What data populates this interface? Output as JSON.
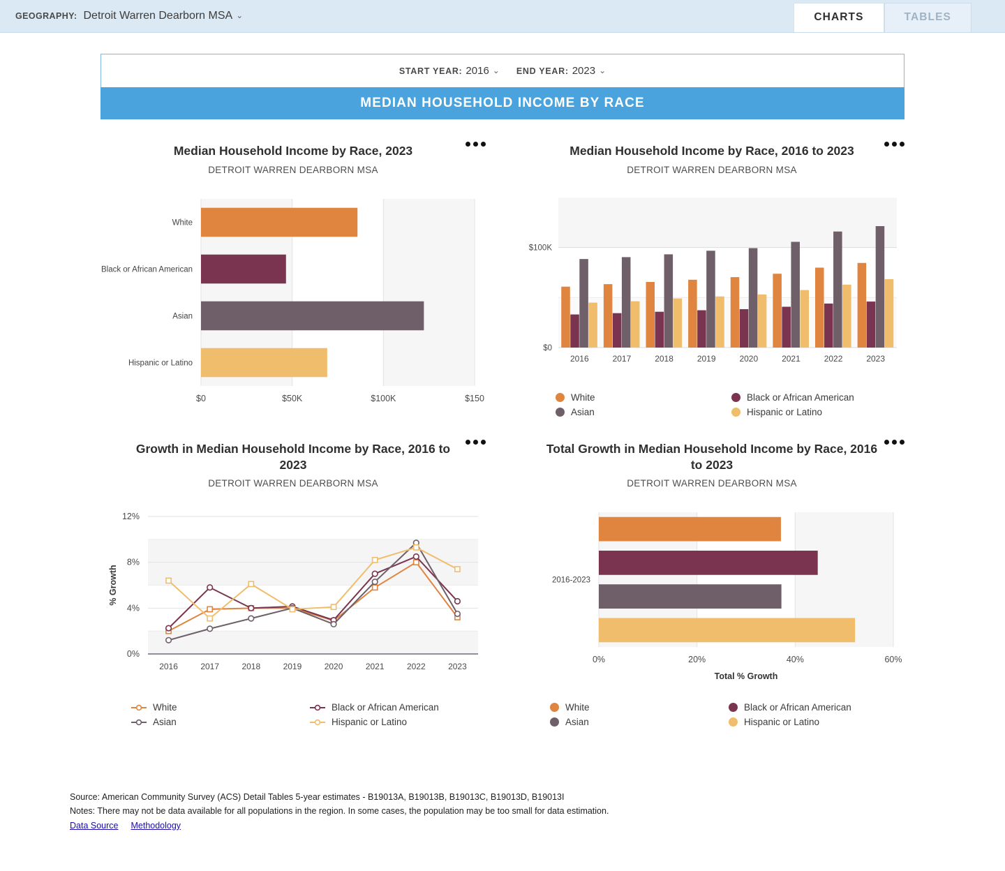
{
  "header": {
    "geography_label": "GEOGRAPHY:",
    "geography_value": "Detroit Warren Dearborn MSA",
    "tabs": [
      {
        "label": "CHARTS",
        "active": true
      },
      {
        "label": "TABLES",
        "active": false
      }
    ]
  },
  "controls": {
    "start_year_label": "START YEAR:",
    "start_year_value": "2016",
    "end_year_label": "END YEAR:",
    "end_year_value": "2023",
    "banner_title": "MEDIAN HOUSEHOLD INCOME BY RACE"
  },
  "colors": {
    "white": "#e08540",
    "black": "#7b3450",
    "asian": "#6f5f69",
    "hispanic": "#efbd6c",
    "accent": "#4aa3dd",
    "top_bar": "#dbe9f4",
    "band": "#f4f4f4"
  },
  "subtitle": "DETROIT WARREN DEARBORN MSA",
  "races": [
    "White",
    "Black or African American",
    "Asian",
    "Hispanic or Latino"
  ],
  "chart_data": [
    {
      "id": "income-2023",
      "type": "bar",
      "orientation": "horizontal",
      "title": "Median Household Income by Race, 2023",
      "subtitle": "DETROIT WARREN DEARBORN MSA",
      "categories": [
        "White",
        "Black or African American",
        "Asian",
        "Hispanic or Latino"
      ],
      "values": [
        85800,
        46600,
        122200,
        69200
      ],
      "colors": [
        "#e08540",
        "#7b3450",
        "#6f5f69",
        "#efbd6c"
      ],
      "xlabel": "",
      "ylabel": "",
      "xlim": [
        0,
        150000
      ],
      "xticks": [
        0,
        50000,
        100000,
        150000
      ],
      "xticklabels": [
        "$0",
        "$50K",
        "$100K",
        "$150"
      ],
      "grid": true,
      "legend": "none"
    },
    {
      "id": "income-series",
      "type": "bar",
      "orientation": "vertical",
      "grouped": true,
      "title": "Median Household Income by Race, 2016 to 2023",
      "subtitle": "DETROIT WARREN DEARBORN MSA",
      "categories": [
        "2016",
        "2017",
        "2018",
        "2019",
        "2020",
        "2021",
        "2022",
        "2023"
      ],
      "series": [
        {
          "name": "White",
          "color": "#e08540",
          "values": [
            60900,
            63400,
            65600,
            67800,
            70400,
            73800,
            79900,
            84600
          ]
        },
        {
          "name": "Black or African American",
          "color": "#7b3450",
          "values": [
            33100,
            34400,
            35800,
            37300,
            38400,
            40800,
            44000,
            46000
          ]
        },
        {
          "name": "Asian",
          "color": "#6f5f69",
          "values": [
            88500,
            90400,
            93200,
            96800,
            99400,
            105700,
            116000,
            121400
          ]
        },
        {
          "name": "Hispanic or Latino",
          "color": "#efbd6c",
          "values": [
            44900,
            46300,
            49100,
            51100,
            53100,
            57500,
            62900,
            68400
          ]
        }
      ],
      "ylim": [
        0,
        150000
      ],
      "yticks": [
        0,
        100000
      ],
      "yticklabels": [
        "$0",
        "$100K"
      ],
      "xlabel": "",
      "ylabel": "",
      "grid": true,
      "legend": "bottom",
      "legend_entries": [
        "White",
        "Black or African American",
        "Asian",
        "Hispanic or Latino"
      ]
    },
    {
      "id": "growth-lines",
      "type": "line",
      "title": "Growth in Median Household Income by Race, 2016 to 2023",
      "subtitle": "DETROIT WARREN DEARBORN MSA",
      "x": [
        "2016",
        "2017",
        "2018",
        "2019",
        "2020",
        "2021",
        "2022",
        "2023"
      ],
      "series": [
        {
          "name": "White",
          "color": "#e08540",
          "marker": "square",
          "values": [
            2.0,
            3.9,
            4.0,
            4.0,
            2.9,
            5.8,
            8.0,
            3.2
          ]
        },
        {
          "name": "Black or African American",
          "color": "#7b3450",
          "marker": "circle",
          "values": [
            2.25,
            5.8,
            4.0,
            4.15,
            2.95,
            7.0,
            8.5,
            4.6
          ]
        },
        {
          "name": "Asian",
          "color": "#6f5f69",
          "marker": "circle",
          "values": [
            1.2,
            2.2,
            3.1,
            4.0,
            2.6,
            6.3,
            9.7,
            3.5
          ]
        },
        {
          "name": "Hispanic or Latino",
          "color": "#efbd6c",
          "marker": "square",
          "values": [
            6.4,
            3.1,
            6.1,
            3.9,
            4.1,
            8.2,
            9.3,
            7.4
          ]
        }
      ],
      "ylim": [
        0,
        12
      ],
      "yticks": [
        0,
        4,
        8,
        12
      ],
      "yticklabels": [
        "0%",
        "4%",
        "8%",
        "12%"
      ],
      "ylabel": "% Growth",
      "xlabel": "",
      "grid": true,
      "legend": "bottom",
      "legend_entries": [
        "White",
        "Black or African American",
        "Asian",
        "Hispanic or Latino"
      ]
    },
    {
      "id": "total-growth",
      "type": "bar",
      "orientation": "horizontal",
      "title": "Total Growth in Median Household Income by Race, 2016 to 2023",
      "subtitle": "DETROIT WARREN DEARBORN MSA",
      "categories": [
        "White",
        "Black or African American",
        "Asian",
        "Hispanic or Latino"
      ],
      "group_label": "2016-2023",
      "values": [
        37.1,
        44.6,
        37.2,
        52.2
      ],
      "colors": [
        "#e08540",
        "#7b3450",
        "#6f5f69",
        "#efbd6c"
      ],
      "xlim": [
        0,
        60
      ],
      "xticks": [
        0,
        20,
        40,
        60
      ],
      "xticklabels": [
        "0%",
        "20%",
        "40%",
        "60%"
      ],
      "xlabel": "Total % Growth",
      "ylabel": "",
      "grid": true,
      "legend": "bottom",
      "legend_entries": [
        "White",
        "Black or African American",
        "Asian",
        "Hispanic or Latino"
      ]
    }
  ],
  "footer": {
    "source": "Source: American Community Survey (ACS) Detail Tables 5-year estimates - B19013A, B19013B, B19013C, B19013D, B19013I",
    "notes": "Notes: There may not be data available for all populations in the region. In some cases, the population may be too small for data estimation.",
    "links": [
      {
        "label": "Data Source"
      },
      {
        "label": "Methodology"
      }
    ]
  }
}
